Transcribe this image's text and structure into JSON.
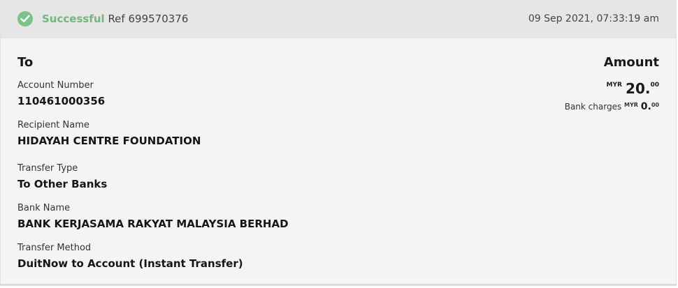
{
  "header": {
    "status": "Successful",
    "ref_label": "Ref",
    "ref_number": "699570376",
    "datetime": "09 Sep 2021, 07:33:19 am",
    "status_color": "#75b57f",
    "icon": "check-circle-icon"
  },
  "recipient": {
    "heading": "To",
    "fields": [
      {
        "label": "Account Number",
        "value": "110461000356"
      },
      {
        "label": "Recipient Name",
        "value": "HIDAYAH CENTRE FOUNDATION"
      },
      {
        "label": "Transfer Type",
        "value": "To Other Banks"
      },
      {
        "label": "Bank Name",
        "value": "BANK KERJASAMA RAKYAT MALAYSIA BERHAD"
      },
      {
        "label": "Transfer Method",
        "value": "DuitNow to Account (Instant Transfer)"
      }
    ]
  },
  "amount": {
    "heading": "Amount",
    "currency": "MYR",
    "whole": "20.",
    "decimal": "00",
    "charges_label": "Bank charges",
    "charges_currency": "MYR",
    "charges_whole": "0.",
    "charges_decimal": "00"
  }
}
